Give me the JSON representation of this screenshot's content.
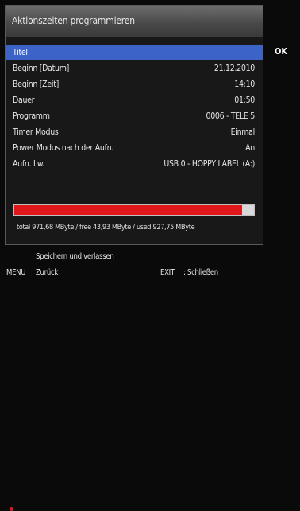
{
  "dialog": {
    "title": "Aktionszeiten programmieren",
    "ok_label": "OK",
    "rows": [
      {
        "label": "Titel",
        "value": ""
      },
      {
        "label": "Beginn [Datum]",
        "value": "21.12.2010"
      },
      {
        "label": "Beginn [Zeit]",
        "value": "14:10"
      },
      {
        "label": "Dauer",
        "value": "01:50"
      },
      {
        "label": "Programm",
        "value": "0006 - TELE 5"
      },
      {
        "label": "Timer Modus",
        "value": "Einmal"
      },
      {
        "label": "Power Modus nach der Aufn.",
        "value": "An"
      },
      {
        "label": "Aufn. Lw.",
        "value": "USB 0 - HOPPY LABEL  (A:)"
      }
    ],
    "storage": {
      "used_fraction": 0.95,
      "text": "total 971,68 MByte / free 43,93 MByte / used 927,75 MByte"
    }
  },
  "footer": {
    "red_action": ": Speichern und verlassen",
    "menu_key": "MENU",
    "menu_action": ": Zurück",
    "exit_key": "EXIT",
    "exit_action": ": Schließen"
  },
  "colors": {
    "selection": "#3b63c8",
    "storage_bar": "#e0181c"
  }
}
